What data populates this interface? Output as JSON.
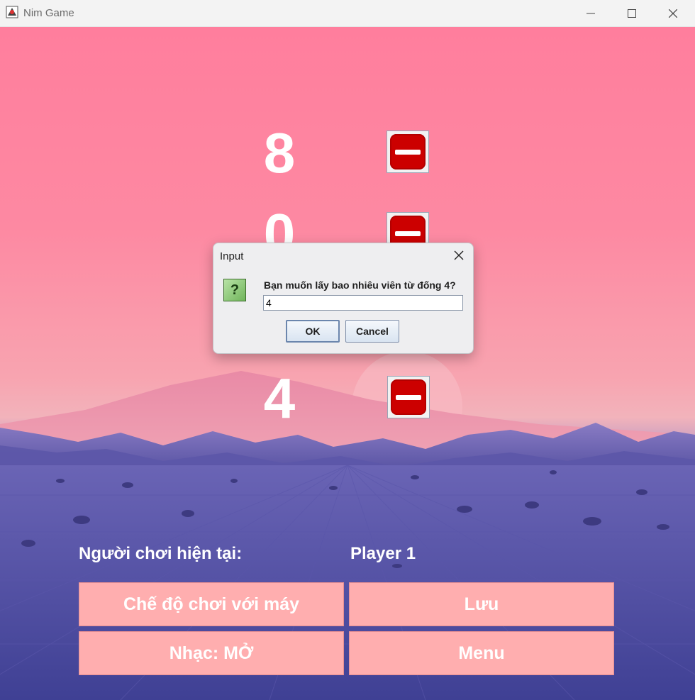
{
  "window": {
    "title": "Nim Game",
    "icon": "java-app-icon",
    "controls": [
      "minimize-icon",
      "maximize-icon",
      "close-icon"
    ]
  },
  "piles": [
    {
      "count": "8"
    },
    {
      "count": "0"
    },
    {
      "count": "4"
    }
  ],
  "status": {
    "current_player_label": "Người chơi hiện tại:",
    "current_player": "Player 1"
  },
  "buttons": {
    "mode": "Chế độ chơi với máy",
    "save": "Lưu",
    "music": "Nhạc: MỞ",
    "menu": "Menu"
  },
  "dialog": {
    "title": "Input",
    "message": "Bạn muốn lấy bao nhiêu viên từ đống 4?",
    "input_value": "4",
    "ok_label": "OK",
    "cancel_label": "Cancel",
    "icon": "question-icon",
    "icon_glyph": "?"
  },
  "colors": {
    "button_bg": "#ffaeaf",
    "minus_red": "#cc0000",
    "sky_pink": "#ff7e9d",
    "ground_purple": "#4e4da0"
  }
}
